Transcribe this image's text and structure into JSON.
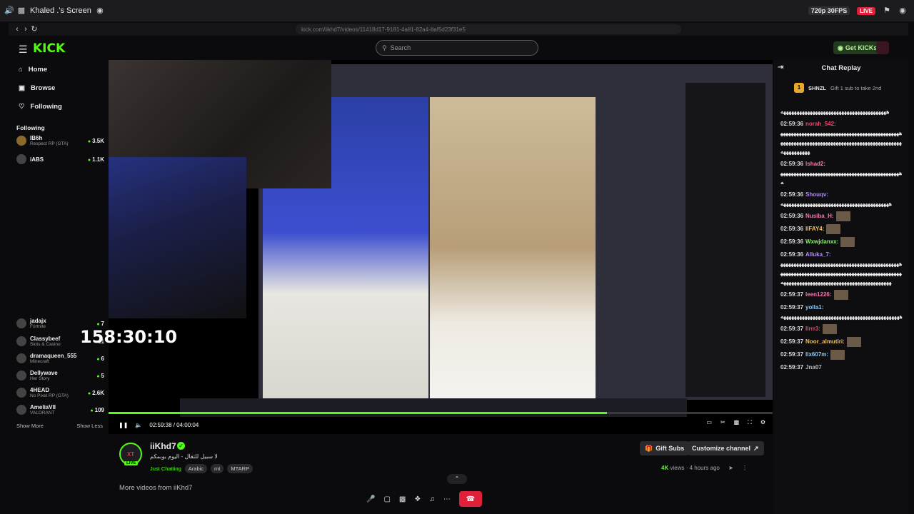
{
  "share_bar": {
    "screen_name": "Khaled .'s Screen",
    "quality": "720p 30FPS",
    "live": "LIVE"
  },
  "browser": {
    "url": "kick.com/iikhd7/videos/11418d17-9181-4a81-82a4-8af5d23f31e5"
  },
  "kick": {
    "logo": "KICK",
    "search_placeholder": "Search",
    "get_kicks": "Get KICKs"
  },
  "sidebar": {
    "nav": [
      {
        "label": "Home",
        "icon": "home-icon"
      },
      {
        "label": "Browse",
        "icon": "compass-icon"
      },
      {
        "label": "Following",
        "icon": "heart-icon"
      }
    ],
    "following_title": "Following",
    "channels_top": [
      {
        "name": "IB6h",
        "game": "Respect RP (GTA)",
        "viewers": "3.5K"
      },
      {
        "name": "iABS",
        "game": "",
        "viewers": "1.1K"
      }
    ],
    "channels": [
      {
        "name": "jadajx",
        "game": "Fortnite",
        "viewers": "7"
      },
      {
        "name": "Classybeef",
        "game": "Slots & Casino",
        "viewers": "11"
      },
      {
        "name": "dramaqueen_555",
        "game": "Minecraft",
        "viewers": "6"
      },
      {
        "name": "Dellywave",
        "game": "Her Story",
        "viewers": "5"
      },
      {
        "name": "4HEAD",
        "game": "No Pixel RP (GTA)",
        "viewers": "2.6K"
      },
      {
        "name": "AmeliaVII",
        "game": "VALORANT",
        "viewers": "109"
      }
    ],
    "show_more": "Show More",
    "show_less": "Show Less"
  },
  "overlay_timer": "158:30:10",
  "player": {
    "time": "02:59:38 / 04:00:04",
    "progress": 0.75
  },
  "channel": {
    "avatar_text": "XT",
    "live": "LIVE",
    "name": "iiKhd7",
    "title": "لا سبيل للتقال - اليوم بوبمكم",
    "category": "Just Chatting",
    "tags": [
      "Arabic",
      "mt",
      "MTARP"
    ],
    "gift_subs": "Gift Subs",
    "customize": "Customize channel",
    "views_count": "4K",
    "views_label": "views",
    "ago": "4 hours ago",
    "more_videos": "More videos from iiKhd7"
  },
  "chat": {
    "title": "Chat Replay",
    "pinned_user": "SHNZL",
    "pinned_text": "Gift 1 sub to take 2nd",
    "lines": [
      {
        "time": "",
        "user": "",
        "color": "#ffffff",
        "msg": "ههههههههههههههههههههههههههههههههههههههههه",
        "emote": false
      },
      {
        "time": "02:59:36",
        "user": "norah_542:",
        "color": "#e04a6e",
        "msg": "ههههههههههههههههههههههههههههههههههههههههههههههههههههههههههههههههههههههههههههههههههههههههههههههههههههههه",
        "emote": false
      },
      {
        "time": "02:59:36",
        "user": "lshad2:",
        "color": "#f07ab0",
        "msg": "ههههههههههههههههههههههههههههههههههههههههههههههه",
        "emote": false
      },
      {
        "time": "02:59:36",
        "user": "Shouqv:",
        "color": "#b48ef5",
        "msg": "هههههههههههههههههههههههههههههههههههههههههه",
        "emote": false
      },
      {
        "time": "02:59:36",
        "user": "Nusiba_H:",
        "color": "#f07ab0",
        "msg": "",
        "emote": true
      },
      {
        "time": "02:59:36",
        "user": "IIFAY4:",
        "color": "#f0c060",
        "msg": "",
        "emote": true
      },
      {
        "time": "02:59:36",
        "user": "Wxwjdanxx:",
        "color": "#8ef06e",
        "msg": "",
        "emote": true
      },
      {
        "time": "02:59:36",
        "user": "Alluka_7:",
        "color": "#b48ef5",
        "msg": "هههههههههههههههههههههههههههههههههههههههههههههههههههههههههههههههههههههههههههههههههههههههههههههههههههههههههههههههههههههههههههههههههههههه",
        "emote": false
      },
      {
        "time": "02:59:37",
        "user": "leen1226:",
        "color": "#f07ab0",
        "msg": "",
        "emote": true
      },
      {
        "time": "02:59:37",
        "user": "yolla1:",
        "color": "#8ec9f5",
        "msg": "هههههههههههههههههههههههههههههههههههههههههههههه",
        "emote": false
      },
      {
        "time": "02:59:37",
        "user": "Ilrrr3:",
        "color": "#e04a6e",
        "msg": "",
        "emote": true
      },
      {
        "time": "02:59:37",
        "user": "Noor_almutiri:",
        "color": "#f0c060",
        "msg": "",
        "emote": true
      },
      {
        "time": "02:59:37",
        "user": "llx607m:",
        "color": "#8ec9f5",
        "msg": "",
        "emote": true
      },
      {
        "time": "02:59:37",
        "user": "Jna07",
        "color": "#bbbbbb",
        "msg": "",
        "emote": false
      }
    ]
  },
  "colors": {
    "accent": "#53fc18",
    "leave": "#e0203a"
  }
}
